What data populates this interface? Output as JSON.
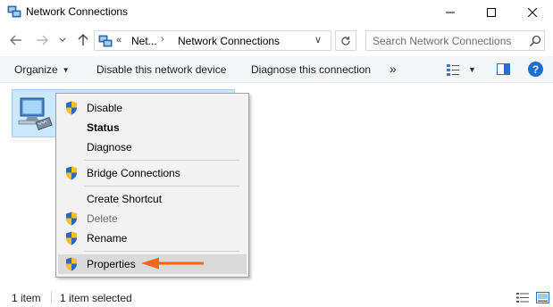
{
  "window": {
    "title": "Network Connections",
    "minimize_label": "Minimize",
    "maximize_label": "Maximize",
    "close_label": "Close"
  },
  "address": {
    "overflow": "«",
    "crumbs": [
      "Net...",
      "Network Connections"
    ],
    "search_placeholder": "Search Network Connections"
  },
  "commands": {
    "organize": "Organize",
    "disable": "Disable this network device",
    "diagnose": "Diagnose this connection",
    "more": "»"
  },
  "context_menu": {
    "items": [
      {
        "label": "Disable",
        "shield": true,
        "bold": false,
        "enabled": true
      },
      {
        "label": "Status",
        "shield": false,
        "bold": true,
        "enabled": true
      },
      {
        "label": "Diagnose",
        "shield": false,
        "bold": false,
        "enabled": true
      },
      {
        "label": "Bridge Connections",
        "shield": true,
        "bold": false,
        "enabled": true
      },
      {
        "label": "Create Shortcut",
        "shield": false,
        "bold": false,
        "enabled": true
      },
      {
        "label": "Delete",
        "shield": true,
        "bold": false,
        "enabled": false
      },
      {
        "label": "Rename",
        "shield": true,
        "bold": false,
        "enabled": true
      },
      {
        "label": "Properties",
        "shield": true,
        "bold": false,
        "enabled": true,
        "highlighted": true
      }
    ]
  },
  "status": {
    "count": "1 item",
    "selected": "1 item selected"
  },
  "colors": {
    "selection_bg": "#cce8ff",
    "selection_border": "#99d1ff",
    "menu_bg": "#f2f2f2",
    "annotation_arrow": "#f26522",
    "help_blue": "#1b6fd1"
  },
  "icons": [
    "network-connections-icon",
    "back-arrow-icon",
    "forward-arrow-icon",
    "chevron-down-icon",
    "up-arrow-icon",
    "refresh-icon",
    "search-icon",
    "view-options-icon",
    "preview-pane-icon",
    "help-icon",
    "network-adapter-icon",
    "uac-shield-icon",
    "details-view-icon",
    "large-icons-view-icon"
  ]
}
